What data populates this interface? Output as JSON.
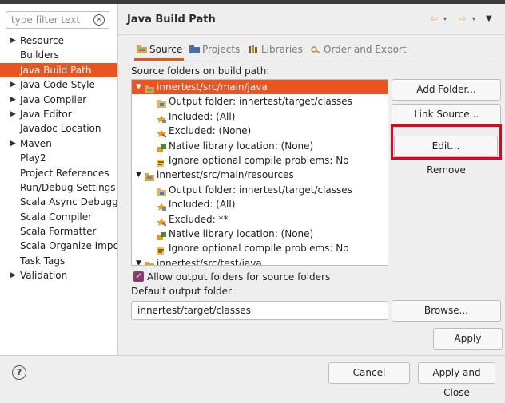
{
  "filter": {
    "placeholder": "type filter text"
  },
  "sidebar": {
    "items": [
      {
        "label": "Resource",
        "expandable": true
      },
      {
        "label": "Builders",
        "expandable": false
      },
      {
        "label": "Java Build Path",
        "expandable": false,
        "selected": true
      },
      {
        "label": "Java Code Style",
        "expandable": true
      },
      {
        "label": "Java Compiler",
        "expandable": true
      },
      {
        "label": "Java Editor",
        "expandable": true
      },
      {
        "label": "Javadoc Location",
        "expandable": false
      },
      {
        "label": "Maven",
        "expandable": true
      },
      {
        "label": "Play2",
        "expandable": false
      },
      {
        "label": "Project References",
        "expandable": false
      },
      {
        "label": "Run/Debug Settings",
        "expandable": false
      },
      {
        "label": "Scala Async Debugger",
        "expandable": false
      },
      {
        "label": "Scala Compiler",
        "expandable": false
      },
      {
        "label": "Scala Formatter",
        "expandable": false
      },
      {
        "label": "Scala Organize Imports",
        "expandable": false
      },
      {
        "label": "Task Tags",
        "expandable": false
      },
      {
        "label": "Validation",
        "expandable": true
      }
    ]
  },
  "header": {
    "title": "Java Build Path"
  },
  "tabs": [
    {
      "label": "Source",
      "active": true
    },
    {
      "label": "Projects",
      "active": false
    },
    {
      "label": "Libraries",
      "active": false
    },
    {
      "label": "Order and Export",
      "active": false
    }
  ],
  "source": {
    "heading": "Source folders on build path:",
    "tree": [
      {
        "label": "innertest/src/main/java",
        "level": 0,
        "expanded": true,
        "selected": true
      },
      {
        "label": "Output folder: innertest/target/classes",
        "level": 1
      },
      {
        "label": "Included: (All)",
        "level": 1
      },
      {
        "label": "Excluded: (None)",
        "level": 1
      },
      {
        "label": "Native library location: (None)",
        "level": 1
      },
      {
        "label": "Ignore optional compile problems: No",
        "level": 1
      },
      {
        "label": "innertest/src/main/resources",
        "level": 0,
        "expanded": true
      },
      {
        "label": "Output folder: innertest/target/classes",
        "level": 1
      },
      {
        "label": "Included: (All)",
        "level": 1
      },
      {
        "label": "Excluded: **",
        "level": 1
      },
      {
        "label": "Native library location: (None)",
        "level": 1
      },
      {
        "label": "Ignore optional compile problems: No",
        "level": 1
      },
      {
        "label": "innertest/src/test/java",
        "level": 0,
        "expanded": true
      }
    ],
    "buttons": {
      "add_folder": "Add Folder...",
      "link_source": "Link Source...",
      "edit": "Edit...",
      "remove": "Remove"
    },
    "allow_output": {
      "label": "Allow output folders for source folders",
      "checked": true
    },
    "default_output_label": "Default output folder:",
    "default_output_value": "innertest/target/classes",
    "browse": "Browse..."
  },
  "footer": {
    "apply": "Apply",
    "cancel": "Cancel",
    "apply_close": "Apply and Close",
    "help_symbol": "?"
  },
  "colors": {
    "accent": "#e95420",
    "highlight": "#e8001c",
    "checkbox": "#8a3b6d"
  }
}
